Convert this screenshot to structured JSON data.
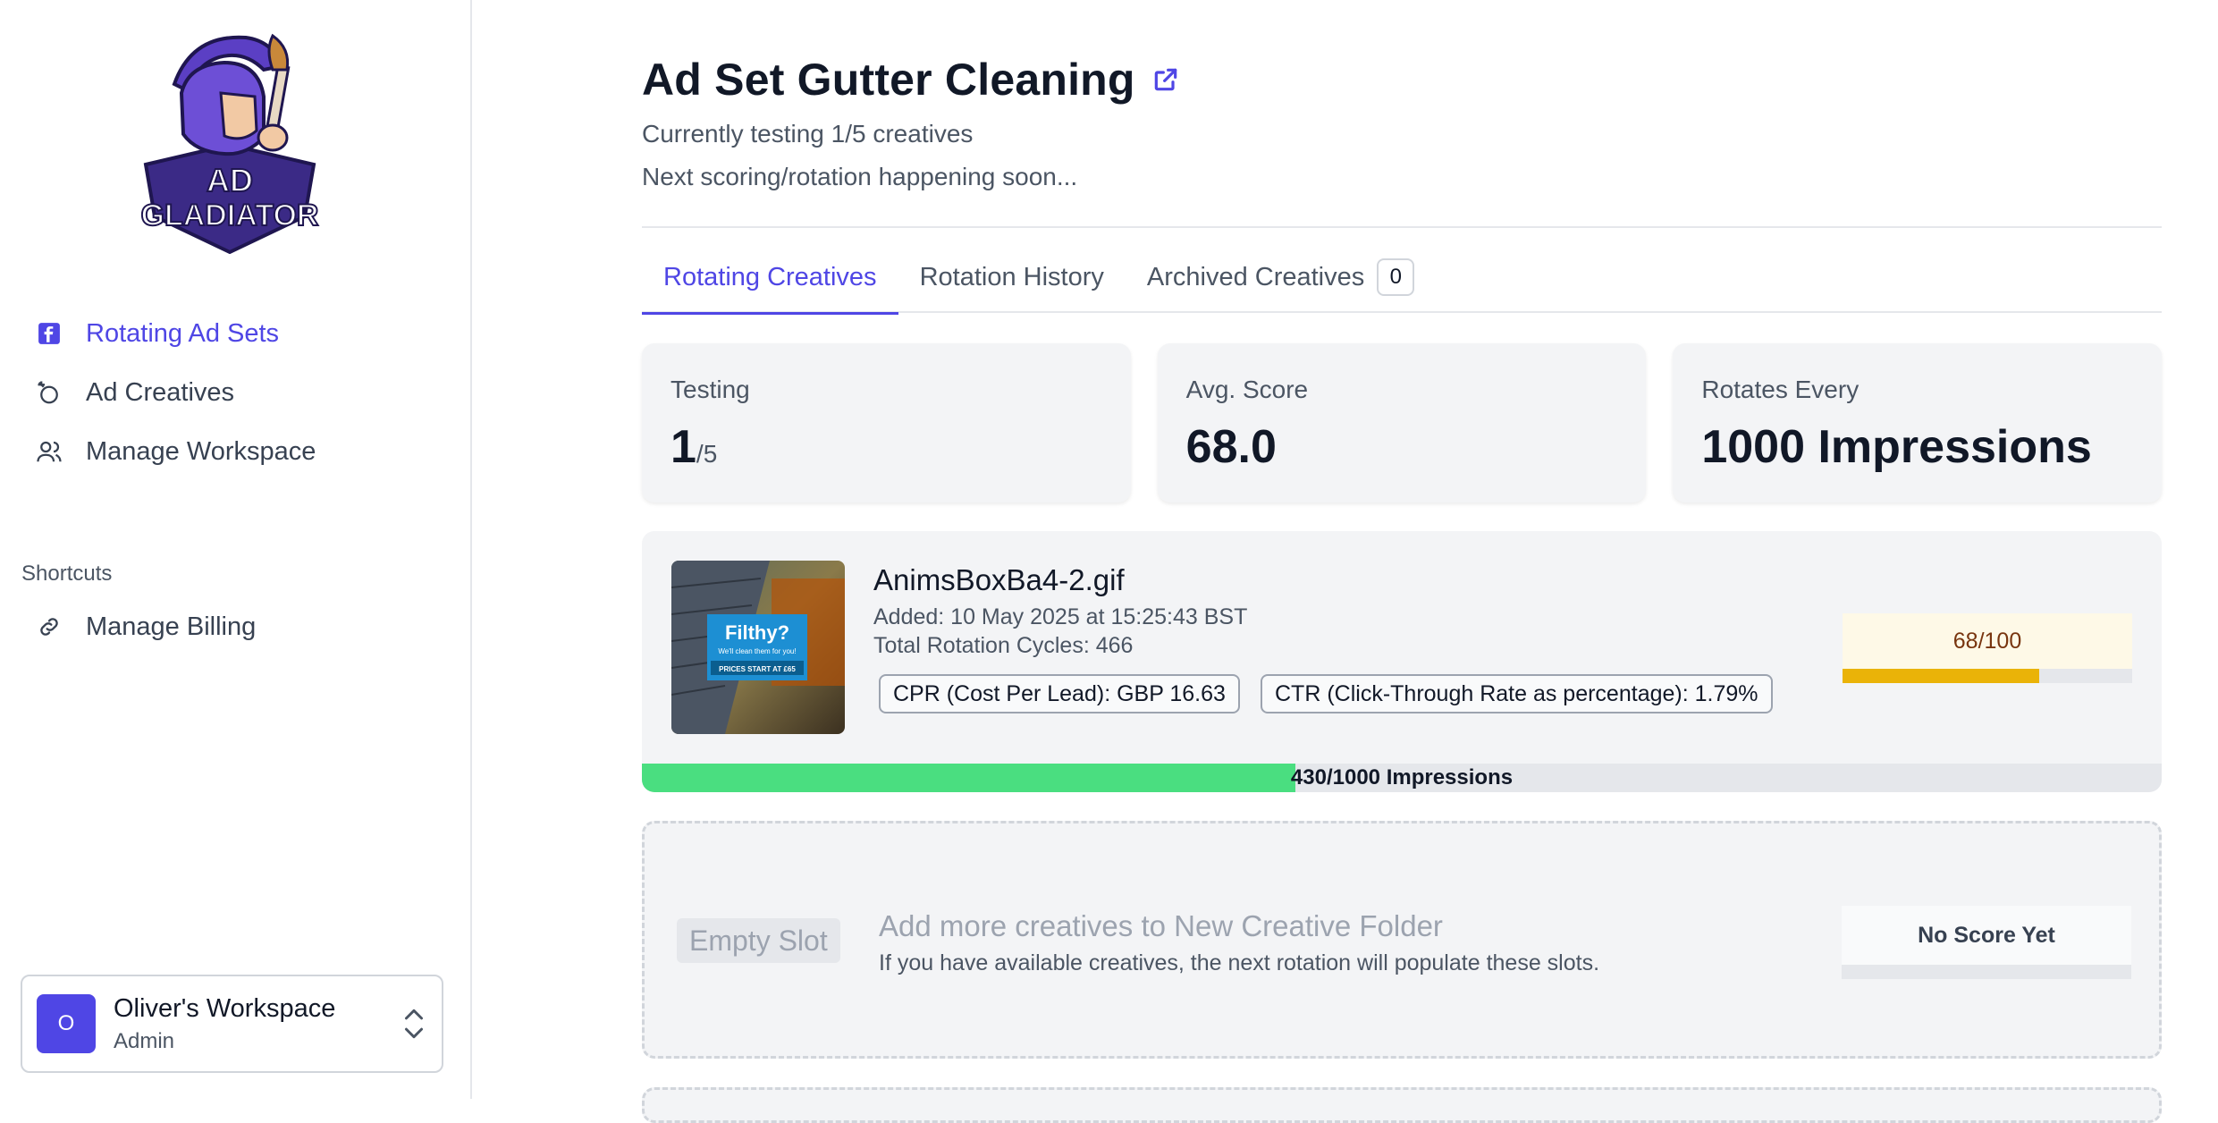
{
  "sidebar": {
    "logo": {
      "line1": "AD",
      "line2": "GLADIATOR"
    },
    "nav": [
      {
        "label": "Rotating Ad Sets",
        "icon": "facebook-icon",
        "active": true
      },
      {
        "label": "Ad Creatives",
        "icon": "sparkle-icon",
        "active": false
      },
      {
        "label": "Manage Workspace",
        "icon": "users-icon",
        "active": false
      }
    ],
    "shortcuts_title": "Shortcuts",
    "shortcuts": [
      {
        "label": "Manage Billing",
        "icon": "link-icon"
      }
    ],
    "workspace": {
      "avatar": "O",
      "name": "Oliver's Workspace",
      "role": "Admin"
    }
  },
  "header": {
    "title": "Ad Set Gutter Cleaning",
    "subtitle": "Currently testing 1/5 creatives",
    "next_rotation": "Next scoring/rotation happening soon..."
  },
  "tabs": [
    {
      "label": "Rotating Creatives",
      "active": true
    },
    {
      "label": "Rotation History",
      "active": false
    },
    {
      "label": "Archived Creatives",
      "active": false,
      "badge": "0"
    }
  ],
  "stats": {
    "testing": {
      "label": "Testing",
      "value": "1",
      "suffix": "/5"
    },
    "avg_score": {
      "label": "Avg. Score",
      "value": "68.0"
    },
    "rotates": {
      "label": "Rotates Every",
      "value": "1000 Impressions"
    }
  },
  "creative": {
    "name": "AnimsBoxBa4-2.gif",
    "added": "Added: 10 May 2025 at 15:25:43 BST",
    "cycles": "Total Rotation Cycles: 466",
    "cpr": "CPR (Cost Per Lead): GBP 16.63",
    "ctr": "CTR (Click-Through Rate as percentage): 1.79%",
    "score_label": "68/100",
    "score_fraction": 0.68,
    "impressions_label": "430/1000 Impressions",
    "impressions_fraction": 0.43,
    "thumb_text": {
      "headline": "Filthy?",
      "sub": "We'll clean them for you!",
      "price": "PRICES START AT £65"
    }
  },
  "empty_slot": {
    "badge": "Empty Slot",
    "title": "Add more creatives to New Creative Folder",
    "subtitle": "If you have available creatives, the next rotation will populate these slots.",
    "score_label": "No Score Yet"
  },
  "colors": {
    "accent": "#4f46e5",
    "score_bar": "#eab308",
    "impressions_bar": "#4ade80"
  }
}
